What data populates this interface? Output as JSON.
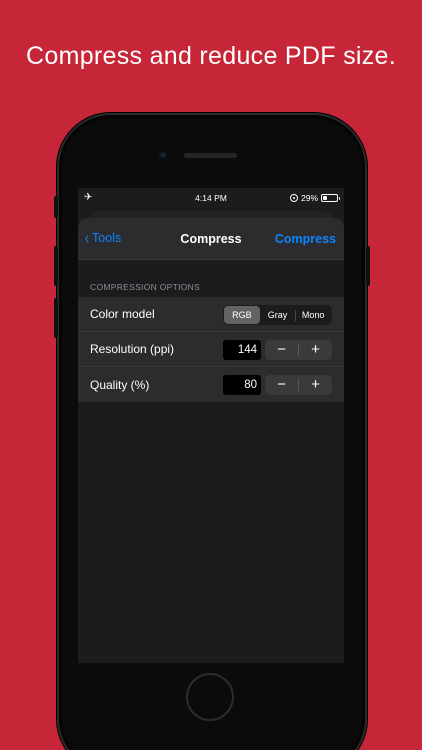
{
  "promo": {
    "headline": "Compress and reduce PDF size."
  },
  "status_bar": {
    "time": "4:14 PM",
    "battery": "29%",
    "battery_level": 0.29
  },
  "nav": {
    "back_label": "Tools",
    "title": "Compress",
    "action_label": "Compress"
  },
  "section": {
    "header": "COMPRESSION OPTIONS"
  },
  "color_model": {
    "label": "Color model",
    "options": [
      "RGB",
      "Gray",
      "Mono"
    ],
    "selected": "RGB"
  },
  "resolution": {
    "label": "Resolution (ppi)",
    "value": "144",
    "minus": "−",
    "plus": "+"
  },
  "quality": {
    "label": "Quality (%)",
    "value": "80",
    "minus": "−",
    "plus": "+"
  },
  "colors": {
    "accent": "#0a84ff",
    "background": "#c62638",
    "sheet": "#1c1c1e",
    "row": "#2c2c2e"
  }
}
